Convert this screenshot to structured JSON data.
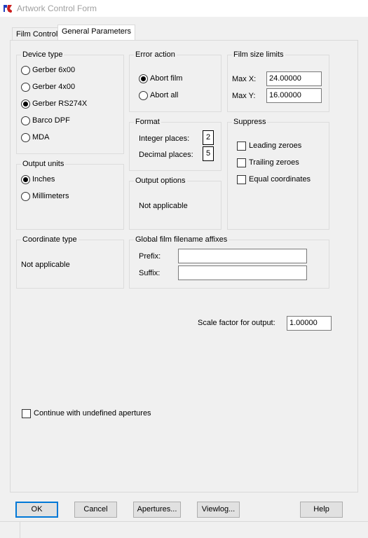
{
  "window": {
    "title": "Artwork Control Form"
  },
  "tabs": [
    {
      "label": "Film Control",
      "active": false
    },
    {
      "label": "General Parameters",
      "active": true
    }
  ],
  "device_type": {
    "title": "Device type",
    "options": [
      "Gerber 6x00",
      "Gerber 4x00",
      "Gerber RS274X",
      "Barco DPF",
      "MDA"
    ],
    "selected": "Gerber RS274X"
  },
  "error_action": {
    "title": "Error action",
    "options": [
      "Abort film",
      "Abort all"
    ],
    "selected": "Abort film"
  },
  "film_size_limits": {
    "title": "Film size limits",
    "max_x_label": "Max X:",
    "max_x_value": "24.00000",
    "max_y_label": "Max Y:",
    "max_y_value": "16.00000"
  },
  "format": {
    "title": "Format",
    "integer_label": "Integer places:",
    "integer_value": "2",
    "decimal_label": "Decimal places:",
    "decimal_value": "5"
  },
  "suppress": {
    "title": "Suppress",
    "options": [
      "Leading zeroes",
      "Trailing zeroes",
      "Equal coordinates"
    ],
    "checked": [
      false,
      false,
      false
    ]
  },
  "output_units": {
    "title": "Output units",
    "options": [
      "Inches",
      "Millimeters"
    ],
    "selected": "Inches"
  },
  "output_options": {
    "title": "Output options",
    "text": "Not applicable"
  },
  "coordinate_type": {
    "title": "Coordinate type",
    "text": "Not applicable"
  },
  "affixes": {
    "title": "Global film filename affixes",
    "prefix_label": "Prefix:",
    "prefix_value": "",
    "suffix_label": "Suffix:",
    "suffix_value": ""
  },
  "scale": {
    "label": "Scale factor for output:",
    "value": "1.00000"
  },
  "continue_undefined": {
    "label": "Continue with undefined apertures",
    "checked": false
  },
  "buttons": {
    "ok": "OK",
    "cancel": "Cancel",
    "apertures": "Apertures...",
    "viewlog": "Viewlog...",
    "help": "Help"
  },
  "colors": {
    "accent": "#0078d7",
    "title_text": "#a0a0a0",
    "icon_red": "#cc1f1f",
    "icon_blue": "#1f3fbf"
  }
}
